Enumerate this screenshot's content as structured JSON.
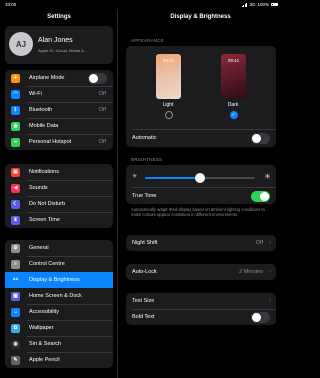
{
  "status": {
    "time": "10:00",
    "carrier": "3G",
    "battery": "100%"
  },
  "sidebar": {
    "title": "Settings",
    "profile": {
      "initials": "AJ",
      "name": "Alan Jones",
      "subtitle": "Apple ID, iCloud, Media &..."
    },
    "group1": [
      {
        "label": "Airplane Mode",
        "icon": "airplane-icon",
        "color": "#ff9500",
        "toggle": false
      },
      {
        "label": "Wi-Fi",
        "icon": "wifi-icon",
        "color": "#0a84ff",
        "value": "Off"
      },
      {
        "label": "Bluetooth",
        "icon": "bluetooth-icon",
        "color": "#0a84ff",
        "value": "Off"
      },
      {
        "label": "Mobile Data",
        "icon": "antenna-icon",
        "color": "#30d158"
      },
      {
        "label": "Personal Hotspot",
        "icon": "hotspot-icon",
        "color": "#30d158",
        "value": "Off"
      }
    ],
    "group2": [
      {
        "label": "Notifications",
        "icon": "notifications-icon",
        "color": "#ff3b30"
      },
      {
        "label": "Sounds",
        "icon": "speaker-icon",
        "color": "#ff2d55"
      },
      {
        "label": "Do Not Disturb",
        "icon": "moon-icon",
        "color": "#5e5ce6"
      },
      {
        "label": "Screen Time",
        "icon": "hourglass-icon",
        "color": "#5e5ce6"
      }
    ],
    "group3": [
      {
        "label": "General",
        "icon": "gear-icon",
        "color": "#8e8e93"
      },
      {
        "label": "Control Centre",
        "icon": "switches-icon",
        "color": "#8e8e93"
      },
      {
        "label": "Display & Brightness",
        "icon": "text-size-icon",
        "color": "#0a84ff",
        "selected": true
      },
      {
        "label": "Home Screen & Dock",
        "icon": "grid-icon",
        "color": "#5e5ce6"
      },
      {
        "label": "Accessibility",
        "icon": "accessibility-icon",
        "color": "#0a84ff"
      },
      {
        "label": "Wallpaper",
        "icon": "flower-icon",
        "color": "#32ade6"
      },
      {
        "label": "Siri & Search",
        "icon": "siri-icon",
        "color": "#2c2c2e"
      },
      {
        "label": "Apple Pencil",
        "icon": "pencil-icon",
        "color": "#636366"
      }
    ]
  },
  "detail": {
    "title": "Display & Brightness",
    "appearance": {
      "header": "APPEARANCE",
      "light": {
        "label": "Light",
        "clock": "09:41",
        "selected": false
      },
      "dark": {
        "label": "Dark",
        "clock": "09:41",
        "selected": true
      },
      "automatic_label": "Automatic",
      "automatic_on": false
    },
    "brightness": {
      "header": "BRIGHTNESS",
      "level": 0.5,
      "true_tone_label": "True Tone",
      "true_tone_on": true,
      "note": "Automatically adapt iPad display based on ambient lighting conditions to make colours appear consistent in different environments."
    },
    "night_shift": {
      "label": "Night Shift",
      "value": "Off"
    },
    "auto_lock": {
      "label": "Auto-Lock",
      "value": "2 Minutes"
    },
    "text_size": {
      "label": "Text Size"
    },
    "bold_text": {
      "label": "Bold Text",
      "on": false
    }
  }
}
